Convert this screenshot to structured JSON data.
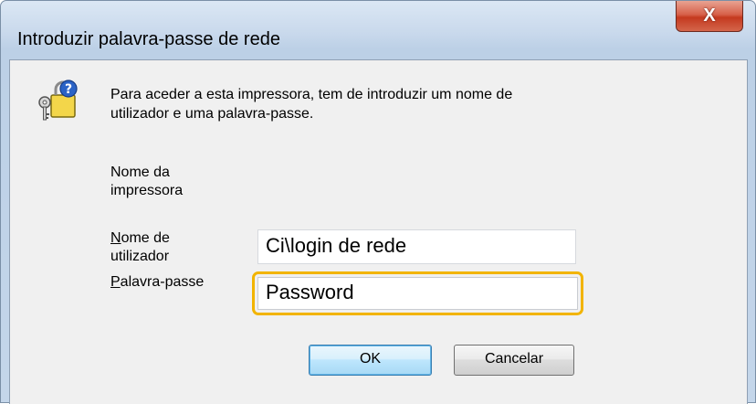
{
  "window": {
    "title": "Introduzir palavra-passe de rede",
    "close_label": "X"
  },
  "message": {
    "line1": "Para aceder a esta impressora, tem de introduzir um nome de",
    "line2": "utilizador e uma palavra-passe."
  },
  "printer_label": {
    "line1": "Nome da",
    "line2": "impressora"
  },
  "username": {
    "label_access_key": "N",
    "label_rest": "ome de",
    "label_line2": "utilizador",
    "value": "Ci\\login de rede"
  },
  "password": {
    "label_access_key": "P",
    "label_rest": "alavra-passe",
    "value": "Password",
    "highlight_color": "#f2b400"
  },
  "buttons": {
    "ok": "OK",
    "cancel": "Cancelar"
  },
  "icons": {
    "dialog_icon": "key-padlock-question-icon"
  }
}
